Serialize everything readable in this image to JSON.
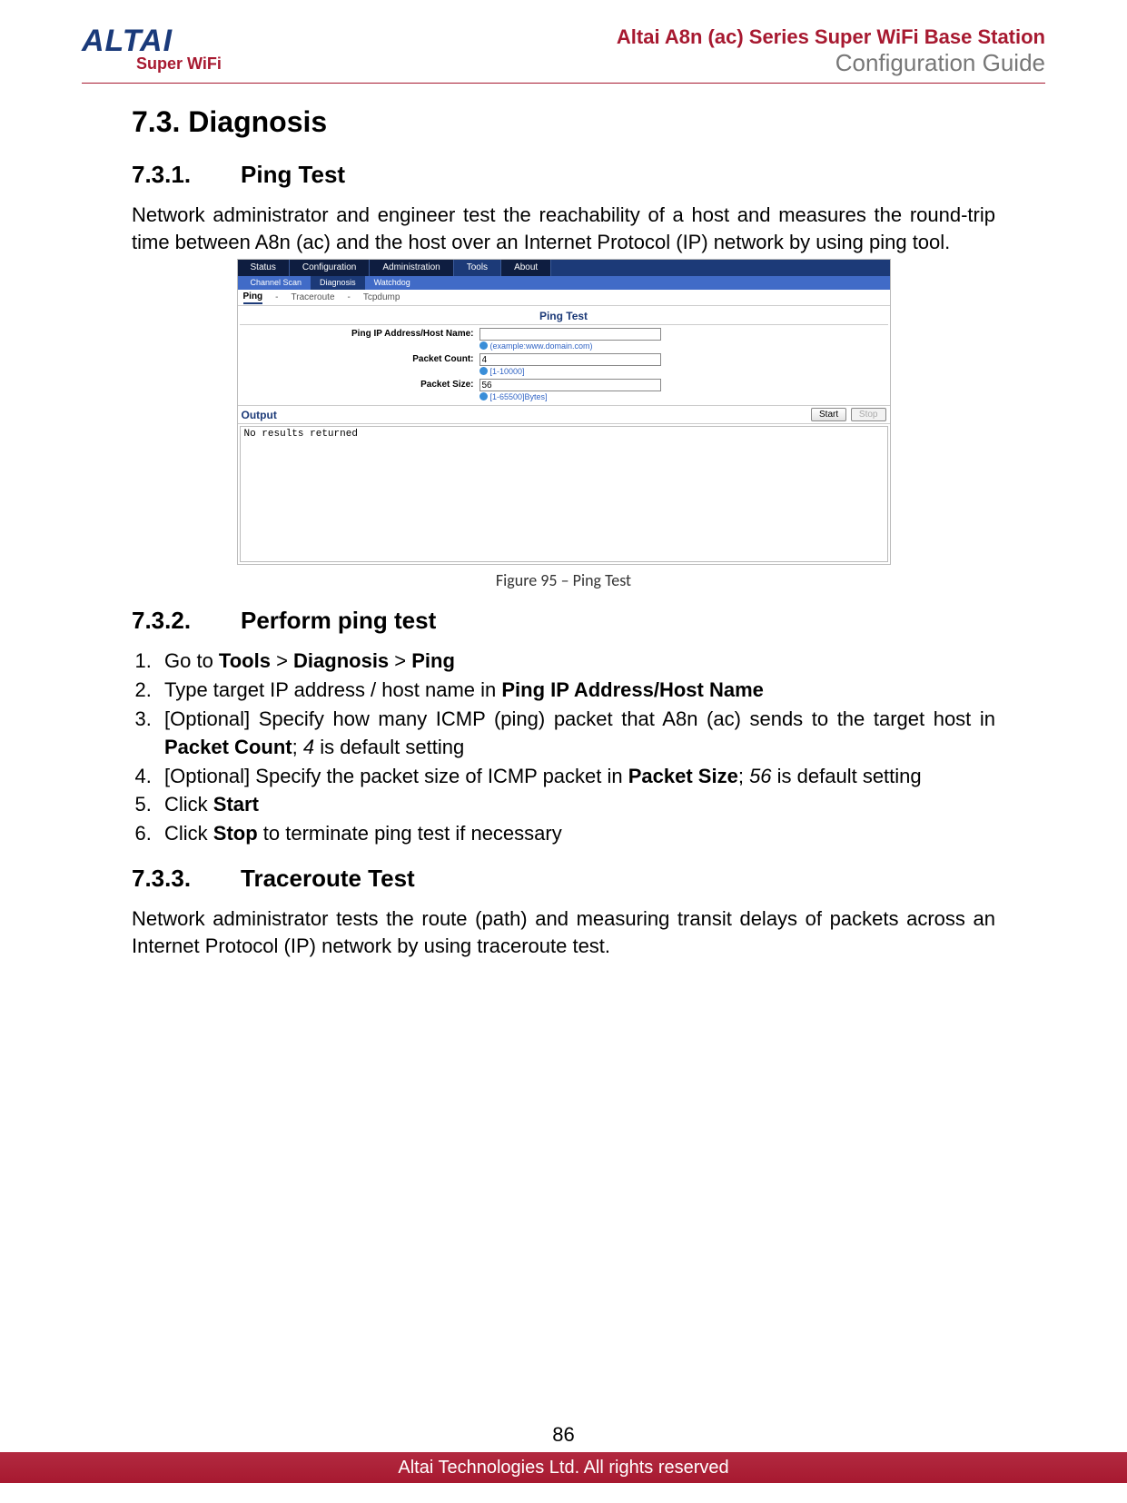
{
  "header": {
    "logo_main": "ALTAI",
    "logo_sub": "Super WiFi",
    "title": "Altai A8n (ac) Series Super WiFi Base Station",
    "subtitle": "Configuration Guide"
  },
  "section": {
    "num": "7.3.",
    "title": "Diagnosis"
  },
  "sub1": {
    "num": "7.3.1.",
    "title": "Ping Test",
    "para": "Network administrator and engineer test the reachability of a host and measures the round-trip time between A8n (ac) and the host over an Internet Protocol (IP) network by using ping tool."
  },
  "figure": {
    "caption": "Figure 95 – Ping Test",
    "tabs": [
      "Status",
      "Configuration",
      "Administration",
      "Tools",
      "About"
    ],
    "subtabs": [
      "Channel Scan",
      "Diagnosis",
      "Watchdog"
    ],
    "crumbs": {
      "active": "Ping",
      "sep1": "-",
      "c2": "Traceroute",
      "sep2": "-",
      "c3": "Tcpdump"
    },
    "panel_title": "Ping Test",
    "fields": {
      "host_label": "Ping IP Address/Host Name:",
      "host_value": "",
      "host_hint": "(example:www.domain.com)",
      "count_label": "Packet Count:",
      "count_value": "4",
      "count_hint": "[1-10000]",
      "size_label": "Packet Size:",
      "size_value": "56",
      "size_hint": "[1-65500]Bytes]"
    },
    "output_title": "Output",
    "btn_start": "Start",
    "btn_stop": "Stop",
    "output_text": "No results returned"
  },
  "sub2": {
    "num": "7.3.2.",
    "title": "Perform ping test",
    "steps": {
      "s1_a": "Go to ",
      "s1_b1": "Tools",
      "s1_gt1": " > ",
      "s1_b2": "Diagnosis",
      "s1_gt2": " > ",
      "s1_b3": "Ping",
      "s2_a": "Type target IP address / host name in ",
      "s2_b": "Ping IP Address/Host Name",
      "s3_a": "[Optional] Specify how many ICMP (ping) packet that A8n (ac) sends to the target host in ",
      "s3_b": "Packet Count",
      "s3_c": "; ",
      "s3_i": "4",
      "s3_d": " is default setting",
      "s4_a": "[Optional] Specify the packet size of ICMP packet in ",
      "s4_b": "Packet Size",
      "s4_c": "; ",
      "s4_i": "56",
      "s4_d": " is default setting",
      "s5_a": "Click ",
      "s5_b": "Start",
      "s6_a": "Click ",
      "s6_b": "Stop",
      "s6_c": " to terminate ping test if necessary"
    }
  },
  "sub3": {
    "num": "7.3.3.",
    "title": "Traceroute Test",
    "para": "Network administrator tests the route (path) and measuring transit delays of packets across an Internet Protocol (IP) network by using traceroute test."
  },
  "footer": {
    "page": "86",
    "copyright": "Altai Technologies Ltd. All rights reserved"
  }
}
